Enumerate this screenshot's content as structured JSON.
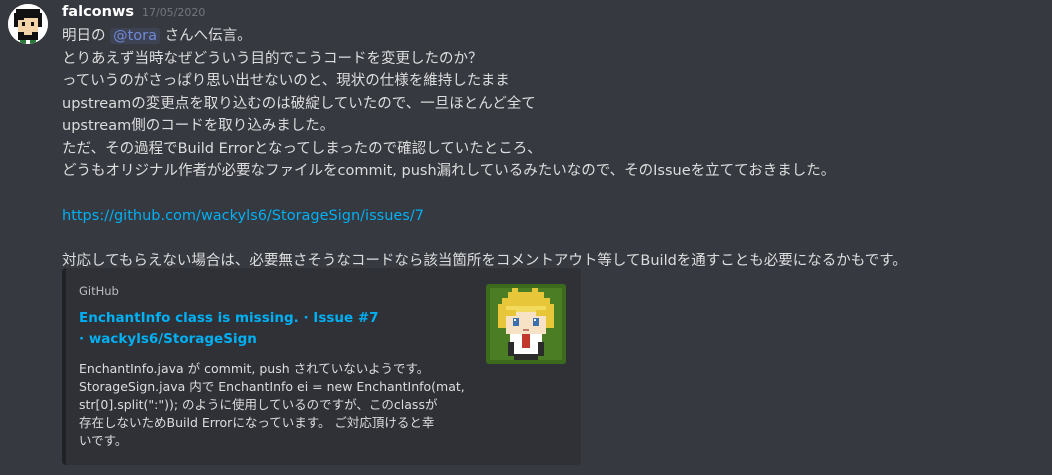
{
  "message": {
    "author": "falconws",
    "timestamp": "17/05/2020",
    "lines": [
      {
        "pre": "明日の",
        "mention": "@tora",
        "post": "さんへ伝言。"
      },
      {
        "text": "とりあえず当時なぜどういう目的でこうコードを変更したのか？"
      },
      {
        "text": "っていうのがさっぱり思い出せないのと、現状の仕様を維持したまま"
      },
      {
        "text": "upstreamの変更点を取り込むのは破綻していたので、一旦ほとんど全て"
      },
      {
        "text": "upstream側のコードを取り込みました。"
      },
      {
        "text": "ただ、その過程でBuild Errorとなってしまったので確認していたところ、"
      },
      {
        "text": "どうもオリジナル作者が必要なファイルをcommit, push漏れしているみたいなので、そのIssueを立てておきました。"
      },
      {
        "text": ""
      },
      {
        "link": "https://github.com/wackyls6/StorageSign/issues/7"
      },
      {
        "text": ""
      },
      {
        "text": "対応してもらえない場合は、必要無さそうなコードなら該当箇所をコメントアウト等してBuildを通すことも必要になるかもです。"
      }
    ]
  },
  "embed": {
    "provider": "GitHub",
    "title": "EnchantInfo class is missing. · Issue #7 · wackyls6/StorageSign",
    "description_lines": [
      "EnchantInfo.java が commit, push されていないようです。",
      "StorageSign.java 内で EnchantInfo ei = new EnchantInfo(mat,",
      "str[0].split(\":\")); のように使用しているのですが、このclassが",
      "存在しないためBuild Errorになっています。 ご対応頂けると幸",
      "いです。"
    ],
    "thumbnail_icon": "anime-character-avatar"
  },
  "colors": {
    "background": "#36393f",
    "embed_background": "#2f3136",
    "link": "#00b0f4",
    "mention": "#7289da",
    "text": "#dcddde",
    "username": "#ffffff",
    "timestamp": "#72767d"
  }
}
